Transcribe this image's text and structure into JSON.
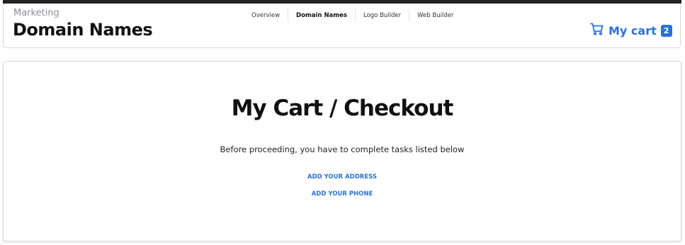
{
  "header": {
    "section": "Marketing",
    "title": "Domain Names",
    "nav": [
      {
        "label": "Overview",
        "active": false
      },
      {
        "label": "Domain Names",
        "active": true
      },
      {
        "label": "Logo Builder",
        "active": false
      },
      {
        "label": "Web Builder",
        "active": false
      }
    ],
    "cart": {
      "label": "My cart",
      "count": "2",
      "icon": "cart-icon"
    }
  },
  "checkout": {
    "title": "My Cart / Checkout",
    "message": "Before proceeding, you have to complete tasks listed below",
    "tasks": [
      "ADD YOUR ADDRESS",
      "ADD YOUR PHONE"
    ]
  },
  "colors": {
    "accent": "#2a72d8",
    "topbar": "#222222"
  }
}
